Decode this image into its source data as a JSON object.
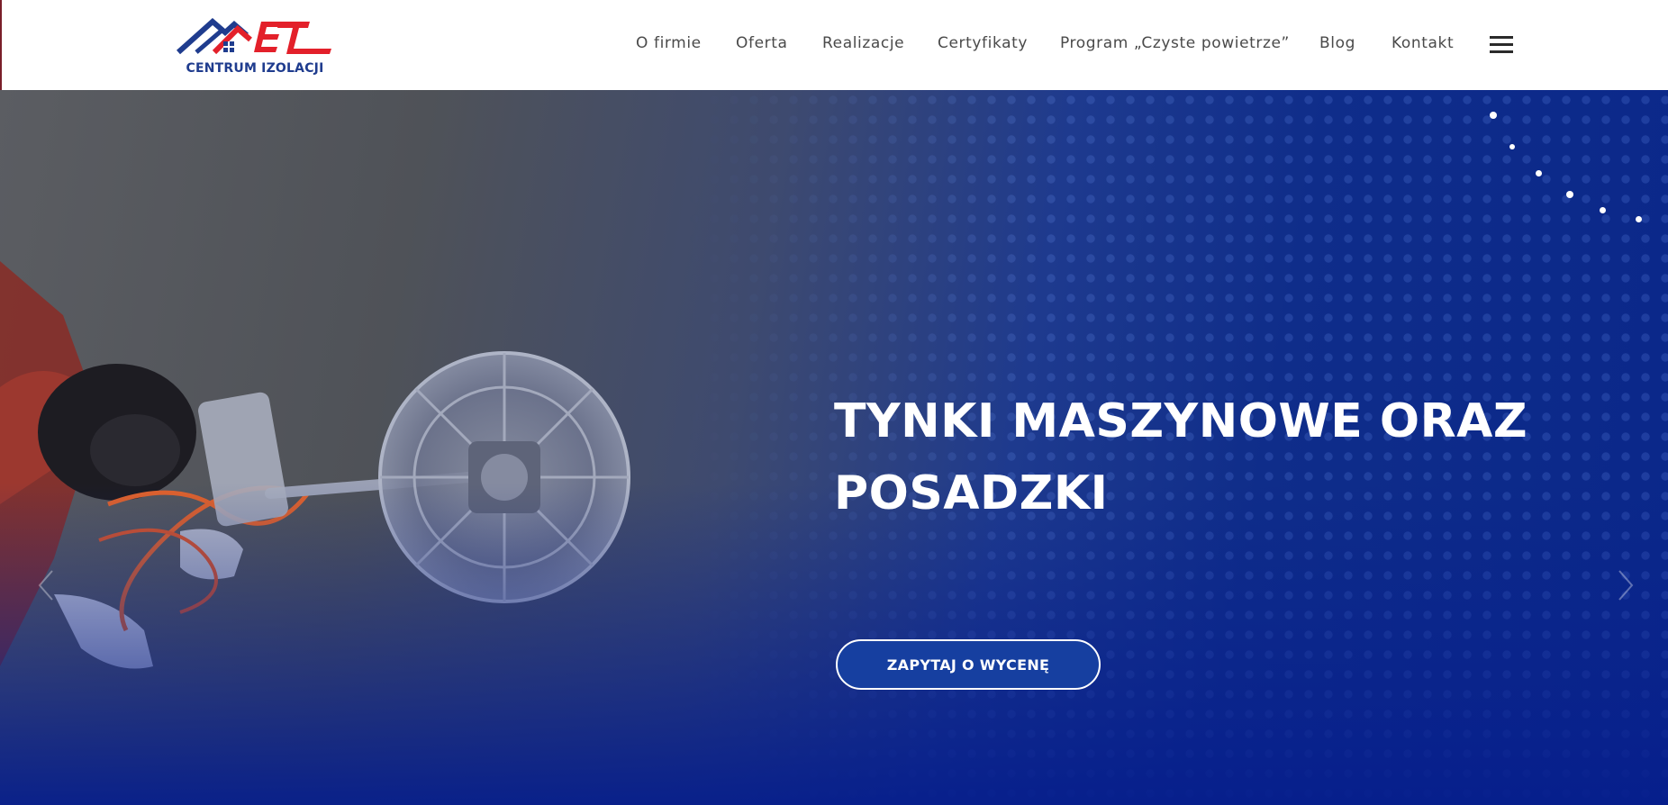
{
  "header": {
    "logo": {
      "text": "CENTRUM IZOLACJI",
      "mark": "ET",
      "icon": "house-roof-logo"
    },
    "nav": [
      {
        "label": "O firmie"
      },
      {
        "label": "Oferta"
      },
      {
        "label": "Realizacje"
      },
      {
        "label": "Certyfikaty"
      },
      {
        "label": "Program „Czyste powietrze”"
      },
      {
        "label": "Blog"
      },
      {
        "label": "Kontakt"
      }
    ],
    "menu_icon": "hamburger-menu-icon"
  },
  "hero": {
    "title_line1": "TYNKI MASZYNOWE ORAZ",
    "title_line2": "POSADZKI",
    "cta_label": "ZAPYTAJ O WYCENĘ",
    "prev_icon": "chevron-left-icon",
    "next_icon": "chevron-right-icon"
  },
  "colors": {
    "brand_blue": "#1f3c8e",
    "brand_red": "#e3202a",
    "hero_blue": "#0a278a",
    "cta_fill": "#163fa0",
    "nav_text": "#4a4a4a"
  }
}
